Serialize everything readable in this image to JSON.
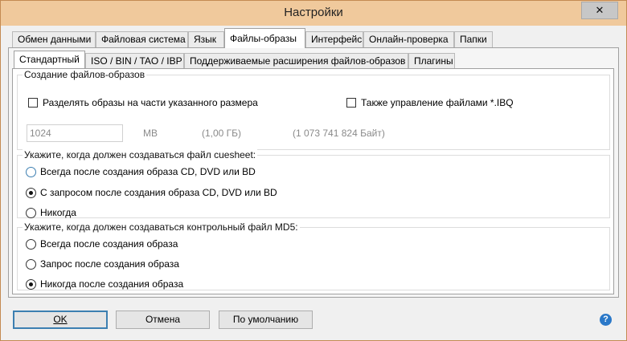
{
  "window": {
    "title": "Настройки",
    "close_glyph": "✕"
  },
  "tabs_top": [
    {
      "label": "Обмен данными"
    },
    {
      "label": "Файловая система"
    },
    {
      "label": "Язык"
    },
    {
      "label": "Файлы-образы"
    },
    {
      "label": "Интерфейс"
    },
    {
      "label": "Онлайн-проверка"
    },
    {
      "label": "Папки"
    }
  ],
  "tabs_top_active": "Файлы-образы",
  "tabs_sub": [
    {
      "label": "Стандартный"
    },
    {
      "label": "ISO / BIN / TAO / IBP"
    },
    {
      "label": "Поддерживаемые расширения файлов-образов"
    },
    {
      "label": "Плагины"
    }
  ],
  "tabs_sub_active": "Стандартный",
  "group_create": {
    "title": "Создание файлов-образов",
    "split_label": "Разделять образы на части указанного размера",
    "split_checked": false,
    "ibq_label": "Также управление файлами *.IBQ",
    "ibq_checked": false,
    "size_value": "1024",
    "size_unit": "MB",
    "size_gb": "(1,00 ГБ)",
    "size_bytes": "(1 073 741 824 Байт)"
  },
  "group_cue": {
    "title": "Укажите, когда должен создаваться файл cuesheet:",
    "options": [
      {
        "label": "Всегда после создания образа CD, DVD или BD",
        "selected": false
      },
      {
        "label": "С запросом после создания образа CD, DVD или BD",
        "selected": true
      },
      {
        "label": "Никогда",
        "selected": false
      }
    ]
  },
  "group_md5": {
    "title": "Укажите, когда должен создаваться контрольный файл MD5:",
    "options": [
      {
        "label": "Всегда после создания образа",
        "selected": false
      },
      {
        "label": "Запрос после создания образа",
        "selected": false
      },
      {
        "label": "Никогда после создания образа",
        "selected": true
      }
    ]
  },
  "buttons": {
    "ok_label": "OK",
    "cancel_label": "Отмена",
    "defaults_label": "По умолчанию"
  },
  "help_glyph": "?",
  "colors": {
    "titlebar": "#f0c99c",
    "window_border": "#c48a52",
    "accent": "#3c7fb1",
    "help": "#2a78c8"
  }
}
